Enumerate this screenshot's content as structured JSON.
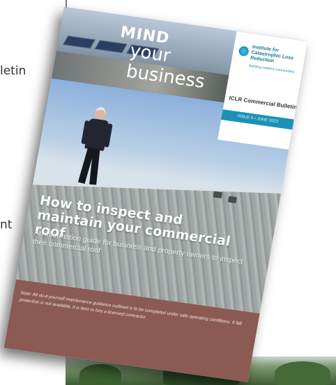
{
  "side_text": {
    "line1": "letin",
    "line2": "nt"
  },
  "cover": {
    "mind": "MIND",
    "your_business": "your business",
    "institute_name": "Institute for Catastrophic Loss Reduction",
    "institute_tagline": "Building resilient communities",
    "bulletin_title": "ICLR Commercial Bulletin",
    "issue": "ISSUE 5 • JUNE 2022",
    "headline": "How to inspect and maintain your commercial roof",
    "subhead": "An information guide for business and property owners to inspect their commercial roof",
    "note": "Note: All do-it-yourself maintenance guidance outlined is to be completed under safe operating conditions. If fall protection is not available, it is best to hire a licensed contractor."
  },
  "colors": {
    "issue_bar": "#1b91b6",
    "note_bar": "#8a5a53",
    "institute_text": "#1e6f9e"
  }
}
